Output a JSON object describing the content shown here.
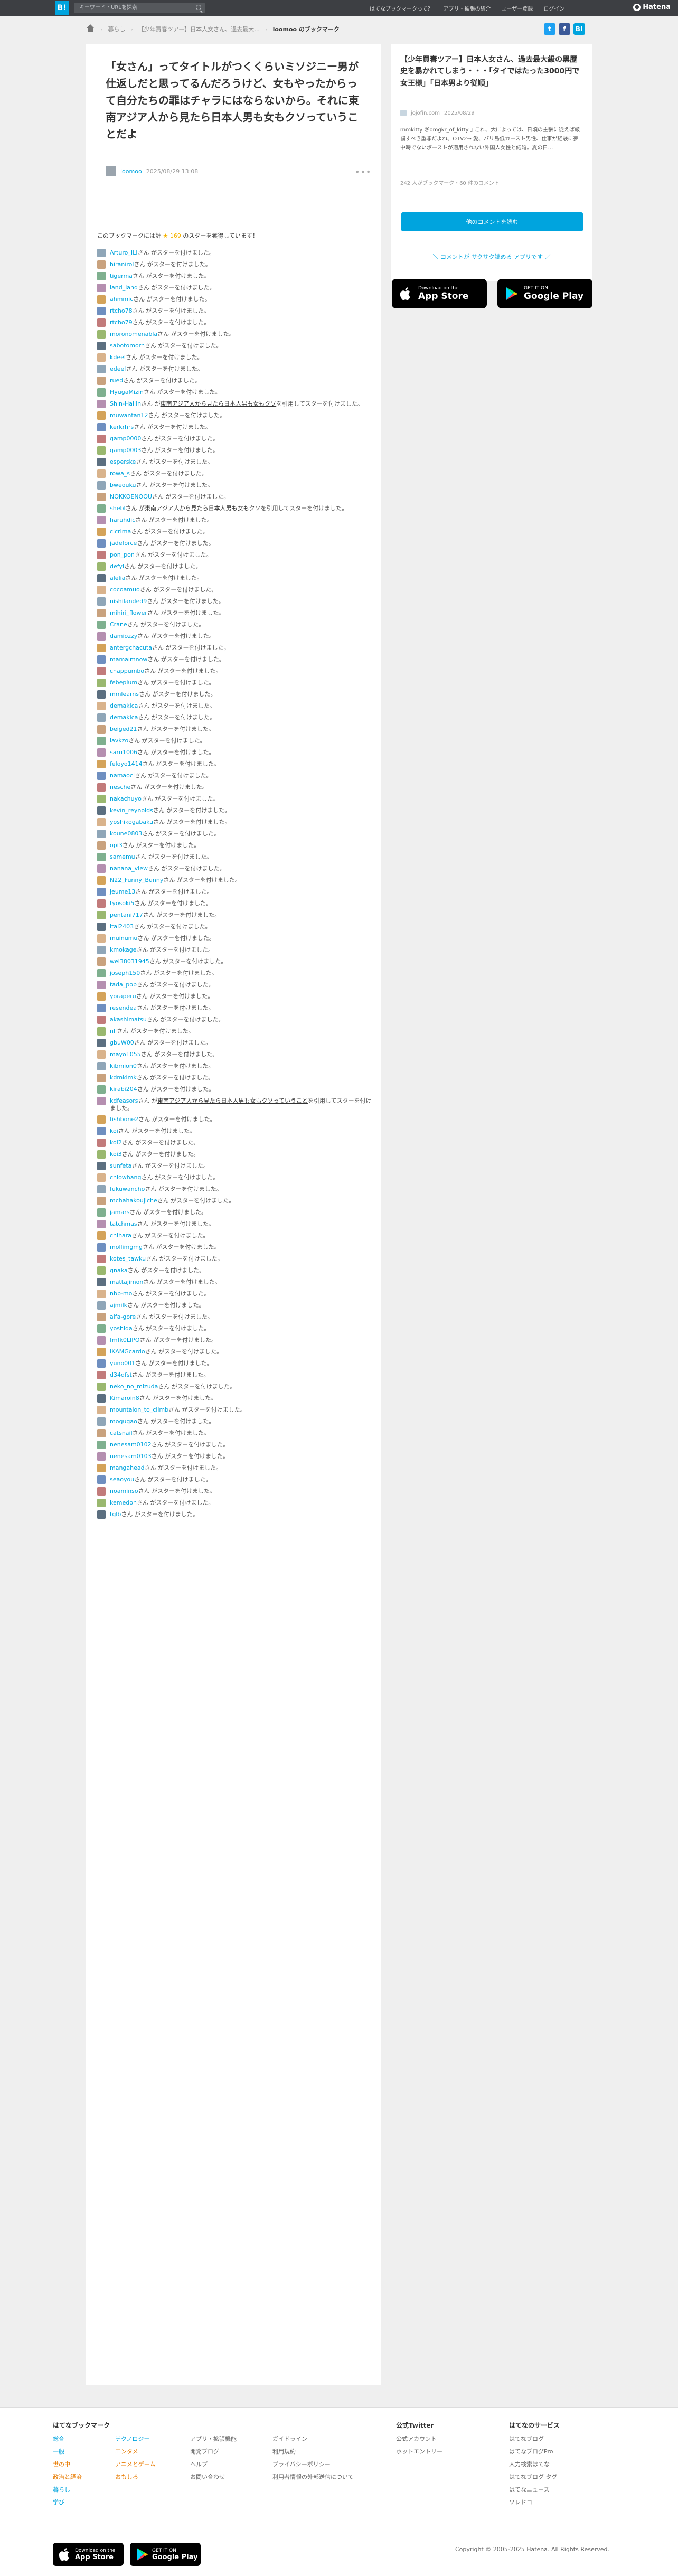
{
  "header": {
    "logo": "B!",
    "search_placeholder": "キーワード・URLを探索",
    "links": [
      "はてなブックマークって？",
      "アプリ・拡張の紹介",
      "ユーザー登録",
      "ログイン"
    ],
    "brand": "Hatena"
  },
  "breadcrumb": {
    "items": [
      "暮らし",
      "【少年買春ツアー】日本人女さん、過去最大…",
      "loomoo のブックマーク"
    ]
  },
  "entry": {
    "title": "「女さん」ってタイトルがつくくらいミソジニー男が仕返しだと思ってるんだろうけど、女もやったからって自分たちの罪はチャラにはならないから。それに東南アジア人から見たら日本人男も女もクソっていうことだよ",
    "author": "loomoo",
    "date": "2025/08/29 13:08",
    "more": "•••"
  },
  "stars": {
    "summary_prefix": "このブックマークには計",
    "summary_count": "169",
    "summary_suffix": "のスターを獲得しています！",
    "star_icon": "★",
    "suffix": "さん がスターを付けました。",
    "quote_mid": "が",
    "quote_end": "を引用してスターを付けました。",
    "list": [
      {
        "user": "Arturo_ILI"
      },
      {
        "user": "hiranirol"
      },
      {
        "user": "tigerma"
      },
      {
        "user": "land_land"
      },
      {
        "user": "ahmmic"
      },
      {
        "user": "rtcho78"
      },
      {
        "user": "rtcho79"
      },
      {
        "user": "moronomenabla"
      },
      {
        "user": "sabotomorn"
      },
      {
        "user": "kdeel"
      },
      {
        "user": "edeel"
      },
      {
        "user": "rued"
      },
      {
        "user": "HyugaMizin"
      },
      {
        "user": "Shin-Hallin",
        "quote": "東南アジア人から見たら日本人男も女もクソ"
      },
      {
        "user": "muwantan12"
      },
      {
        "user": "kerkrhrs"
      },
      {
        "user": "gamp0000"
      },
      {
        "user": "gamp0003"
      },
      {
        "user": "esperske"
      },
      {
        "user": "rowa_s"
      },
      {
        "user": "bweouku"
      },
      {
        "user": "NOKKOENOOU"
      },
      {
        "user": "shebl",
        "quote": "東南アジア人から見たら日本人男も女もクソ"
      },
      {
        "user": "haruhdic"
      },
      {
        "user": "clcrima"
      },
      {
        "user": "jadeforce"
      },
      {
        "user": "pon_pon"
      },
      {
        "user": "defyl"
      },
      {
        "user": "alelia"
      },
      {
        "user": "cocoamuo"
      },
      {
        "user": "nishilanded9"
      },
      {
        "user": "mihiri_flower"
      },
      {
        "user": "Crane"
      },
      {
        "user": "damiozzy"
      },
      {
        "user": "antergchacuta"
      },
      {
        "user": "mamaimnow"
      },
      {
        "user": "chappumbo"
      },
      {
        "user": "febeplum"
      },
      {
        "user": "mmlearns"
      },
      {
        "user": "demakica"
      },
      {
        "user": "demakica"
      },
      {
        "user": "beiged21"
      },
      {
        "user": "lavkzo"
      },
      {
        "user": "saru1006"
      },
      {
        "user": "feloyo1414"
      },
      {
        "user": "namaoci"
      },
      {
        "user": "nesche"
      },
      {
        "user": "nakachuyo"
      },
      {
        "user": "kevin_reynolds"
      },
      {
        "user": "yoshikogabaku"
      },
      {
        "user": "koune0803"
      },
      {
        "user": "opi3"
      },
      {
        "user": "samemu"
      },
      {
        "user": "nanana_view"
      },
      {
        "user": "N22_Funny_Bunny"
      },
      {
        "user": "jeume13"
      },
      {
        "user": "tyosoki5"
      },
      {
        "user": "pentani717"
      },
      {
        "user": "itai2403"
      },
      {
        "user": "muinumu"
      },
      {
        "user": "kmokage"
      },
      {
        "user": "wel38031945"
      },
      {
        "user": "joseph150"
      },
      {
        "user": "tada_pop"
      },
      {
        "user": "yoraperu"
      },
      {
        "user": "resendea"
      },
      {
        "user": "akashimatsu"
      },
      {
        "user": "nll"
      },
      {
        "user": "gbuW00"
      },
      {
        "user": "mayo1055"
      },
      {
        "user": "kibmion0"
      },
      {
        "user": "kdmkimk"
      },
      {
        "user": "kirabi204"
      },
      {
        "user": "kdfeasors",
        "quote": "東南アジア人から見たら日本人男も女もクソっていうこと"
      },
      {
        "user": "fishbone2"
      },
      {
        "user": "koi"
      },
      {
        "user": "koi2"
      },
      {
        "user": "koi3"
      },
      {
        "user": "sunfeta"
      },
      {
        "user": "chiowhang"
      },
      {
        "user": "fukuwancho"
      },
      {
        "user": "mchahakoujiche"
      },
      {
        "user": "jamars"
      },
      {
        "user": "tatchmas"
      },
      {
        "user": "chihara"
      },
      {
        "user": "mollimgmg"
      },
      {
        "user": "kotes_tawku"
      },
      {
        "user": "gnaka"
      },
      {
        "user": "mattajimon"
      },
      {
        "user": "nbb-mo"
      },
      {
        "user": "ajmilk"
      },
      {
        "user": "alfa-gore"
      },
      {
        "user": "yoshida"
      },
      {
        "user": "fmfk0LIPO"
      },
      {
        "user": "IKAMGcardo"
      },
      {
        "user": "yuno001"
      },
      {
        "user": "d34dfst"
      },
      {
        "user": "neko_no_mizuda"
      },
      {
        "user": "Kimaroin8"
      },
      {
        "user": "mountaion_to_climb"
      },
      {
        "user": "mogugao"
      },
      {
        "user": "catsnail"
      },
      {
        "user": "nenesam0102"
      },
      {
        "user": "nenesam0103"
      },
      {
        "user": "mangahead"
      },
      {
        "user": "seaoyou"
      },
      {
        "user": "noaminso"
      },
      {
        "user": "kemedon"
      },
      {
        "user": "tglb"
      }
    ]
  },
  "sidebar": {
    "title": "【少年買春ツアー】日本人女さん、過去最大級の黒歴史を暴かれてしまう・・・「タイではたった3000円で女王様」「日本男より従順」",
    "source": "jojofin.com",
    "date": "2025/08/29",
    "desc": "ｍｍkitty ＠omgkr_of_kitty ｣ これ、大によっては、日頃の主張に従えば厳罰すべき重罪だよね。OTV2→ 愛、バリ島低カースト男性、仕事が経験に夢中時でないポーストが適用されない外国人女性と結婚。夏の日…",
    "count": "242 人がブックマーク・60 件のコメント",
    "comment_button": "他のコメントを読む",
    "app_prompt": "＼ コメントが サクサク読める アプリです ／"
  },
  "stores": {
    "apple_small": "Download on the",
    "apple_big": "App Store",
    "google_small": "GET IT ON",
    "google_big": "Google Play"
  },
  "footer": {
    "col1_title": "はてなブックマーク",
    "col1_a": [
      "総合",
      "一般",
      "世の中",
      "政治と経済",
      "暮らし",
      "学び"
    ],
    "col1_b": [
      "テクノロジー",
      "エンタメ",
      "アニメとゲーム",
      "おもしろ"
    ],
    "col1_c": [
      "アプリ・拡張機能",
      "開発ブログ",
      "ヘルプ",
      "お問い合わせ"
    ],
    "col1_d": [
      "ガイドライン",
      "利用規約",
      "プライバシーポリシー",
      "利用者情報の外部送信について"
    ],
    "col2_title": "公式Twitter",
    "col2": [
      "公式アカウント",
      "ホットエントリー"
    ],
    "col3_title": "はてなのサービス",
    "col3": [
      "はてなブログ",
      "はてなブログPro",
      "人力検索はてな",
      "はてなブログ タグ",
      "はてなニュース",
      "ソレドコ"
    ],
    "copyright": "Copyright © 2005-2025 Hatena. All Rights Reserved."
  },
  "colors": {
    "accent": "#00a4de",
    "header_bg": "#3d3f43",
    "star": "#f5b301"
  }
}
